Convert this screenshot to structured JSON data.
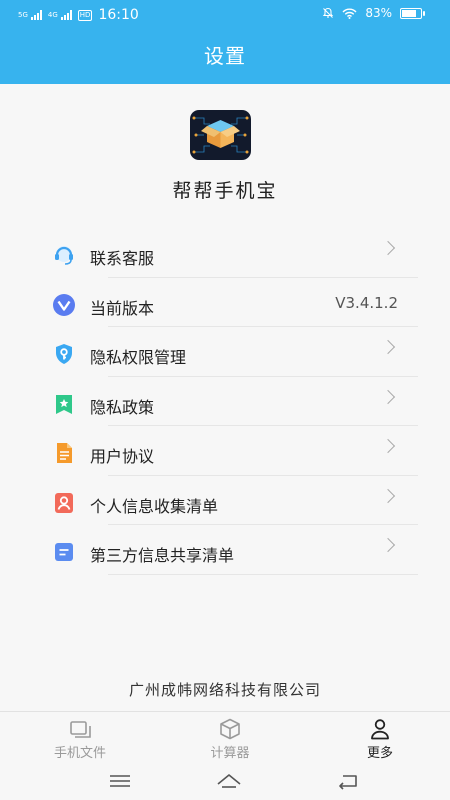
{
  "status_bar": {
    "network_1": "5G",
    "network_2": "4G",
    "hd_badge": "HD",
    "time": "16:10",
    "battery_text": "83%",
    "battery_level": 0.83,
    "icons": [
      "mute-icon",
      "wifi-icon",
      "battery-icon"
    ]
  },
  "header": {
    "title": "设置",
    "background": "#37b3ee"
  },
  "app": {
    "name": "帮帮手机宝"
  },
  "menu": [
    {
      "label": "联系客服",
      "icon": "customer-service-icon",
      "color": "#3ea2f0",
      "chevron": true
    },
    {
      "label": "当前版本",
      "icon": "version-icon",
      "color": "#5a7cf0",
      "value": "V3.4.1.2",
      "chevron": false
    },
    {
      "label": "隐私权限管理",
      "icon": "privacy-shield-icon",
      "color": "#3aa8f2",
      "chevron": true
    },
    {
      "label": "隐私政策",
      "icon": "policy-icon",
      "color": "#2fc88a",
      "chevron": true
    },
    {
      "label": "用户协议",
      "icon": "agreement-icon",
      "color": "#f59a2b",
      "chevron": true
    },
    {
      "label": "个人信息收集清单",
      "icon": "personal-info-icon",
      "color": "#f26a5a",
      "chevron": true
    },
    {
      "label": "第三方信息共享清单",
      "icon": "third-party-share-icon",
      "color": "#5b8cf0",
      "chevron": true
    }
  ],
  "footer": {
    "company": "广州成帏网络科技有限公司"
  },
  "tabs": [
    {
      "label": "手机文件",
      "icon": "phone-files-icon",
      "active": false
    },
    {
      "label": "计算器",
      "icon": "box-icon",
      "active": false
    },
    {
      "label": "更多",
      "icon": "person-icon",
      "active": true
    }
  ],
  "system_nav": [
    "menu-icon",
    "home-icon",
    "back-icon"
  ]
}
